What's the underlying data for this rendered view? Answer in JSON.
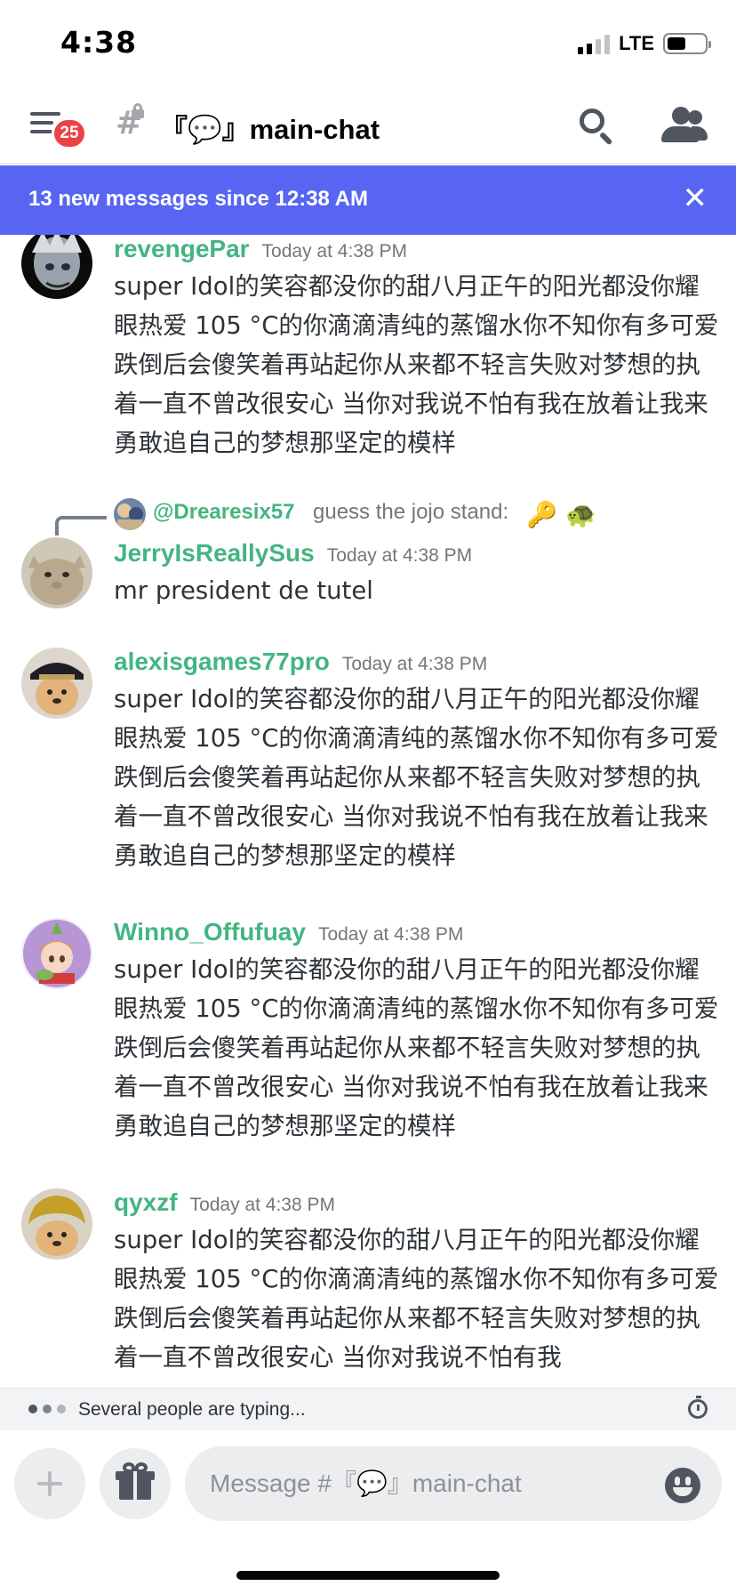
{
  "status_bar": {
    "time": "4:38",
    "network": "LTE"
  },
  "header": {
    "badge_count": "25",
    "channel_hash": "#",
    "channel_name": "『💬』main-chat"
  },
  "new_messages_bar": {
    "text": "13 new messages since 12:38 AM",
    "close": "✕"
  },
  "messages": [
    {
      "username": "revengePar",
      "timestamp": "Today at 4:38 PM",
      "text": "super Idol的笑容都没你的甜八月正午的阳光都没你耀眼热爱 105 °C的你滴滴清纯的蒸馏水你不知你有多可爱跌倒后会傻笑着再站起你从来都不轻言失败对梦想的执着一直不曾改很安心 当你对我说不怕有我在放着让我来勇敢追自己的梦想那坚定的模样"
    },
    {
      "reply_to": {
        "username": "@Drearesix57",
        "text": "guess the jojo stand:",
        "emoji1": "🔑",
        "emoji2": "🐢"
      },
      "username": "JerryIsReallySus",
      "timestamp": "Today at 4:38 PM",
      "text": "mr president de tutel"
    },
    {
      "username": "alexisgames77pro",
      "timestamp": "Today at 4:38 PM",
      "text": "super Idol的笑容都没你的甜八月正午的阳光都没你耀眼热爱 105 °C的你滴滴清纯的蒸馏水你不知你有多可爱跌倒后会傻笑着再站起你从来都不轻言失败对梦想的执着一直不曾改很安心 当你对我说不怕有我在放着让我来勇敢追自己的梦想那坚定的模样"
    },
    {
      "username": "Winno_Offufuay",
      "timestamp": "Today at 4:38 PM",
      "text": "super Idol的笑容都没你的甜八月正午的阳光都没你耀眼热爱 105 °C的你滴滴清纯的蒸馏水你不知你有多可爱跌倒后会傻笑着再站起你从来都不轻言失败对梦想的执着一直不曾改很安心 当你对我说不怕有我在放着让我来勇敢追自己的梦想那坚定的模样"
    },
    {
      "username": "qyxzf",
      "timestamp": "Today at 4:38 PM",
      "text": "super Idol的笑容都没你的甜八月正午的阳光都没你耀眼热爱 105 °C的你滴滴清纯的蒸馏水你不知你有多可爱跌倒后会傻笑着再站起你从来都不轻言失败对梦想的执着一直不曾改很安心 当你对我说不怕有我"
    }
  ],
  "typing": {
    "text": "Several people are typing..."
  },
  "composer": {
    "placeholder": "Message #『💬』main-chat"
  },
  "colors": {
    "accent": "#5865f2",
    "username": "#43b581",
    "badge": "#ed4245"
  }
}
